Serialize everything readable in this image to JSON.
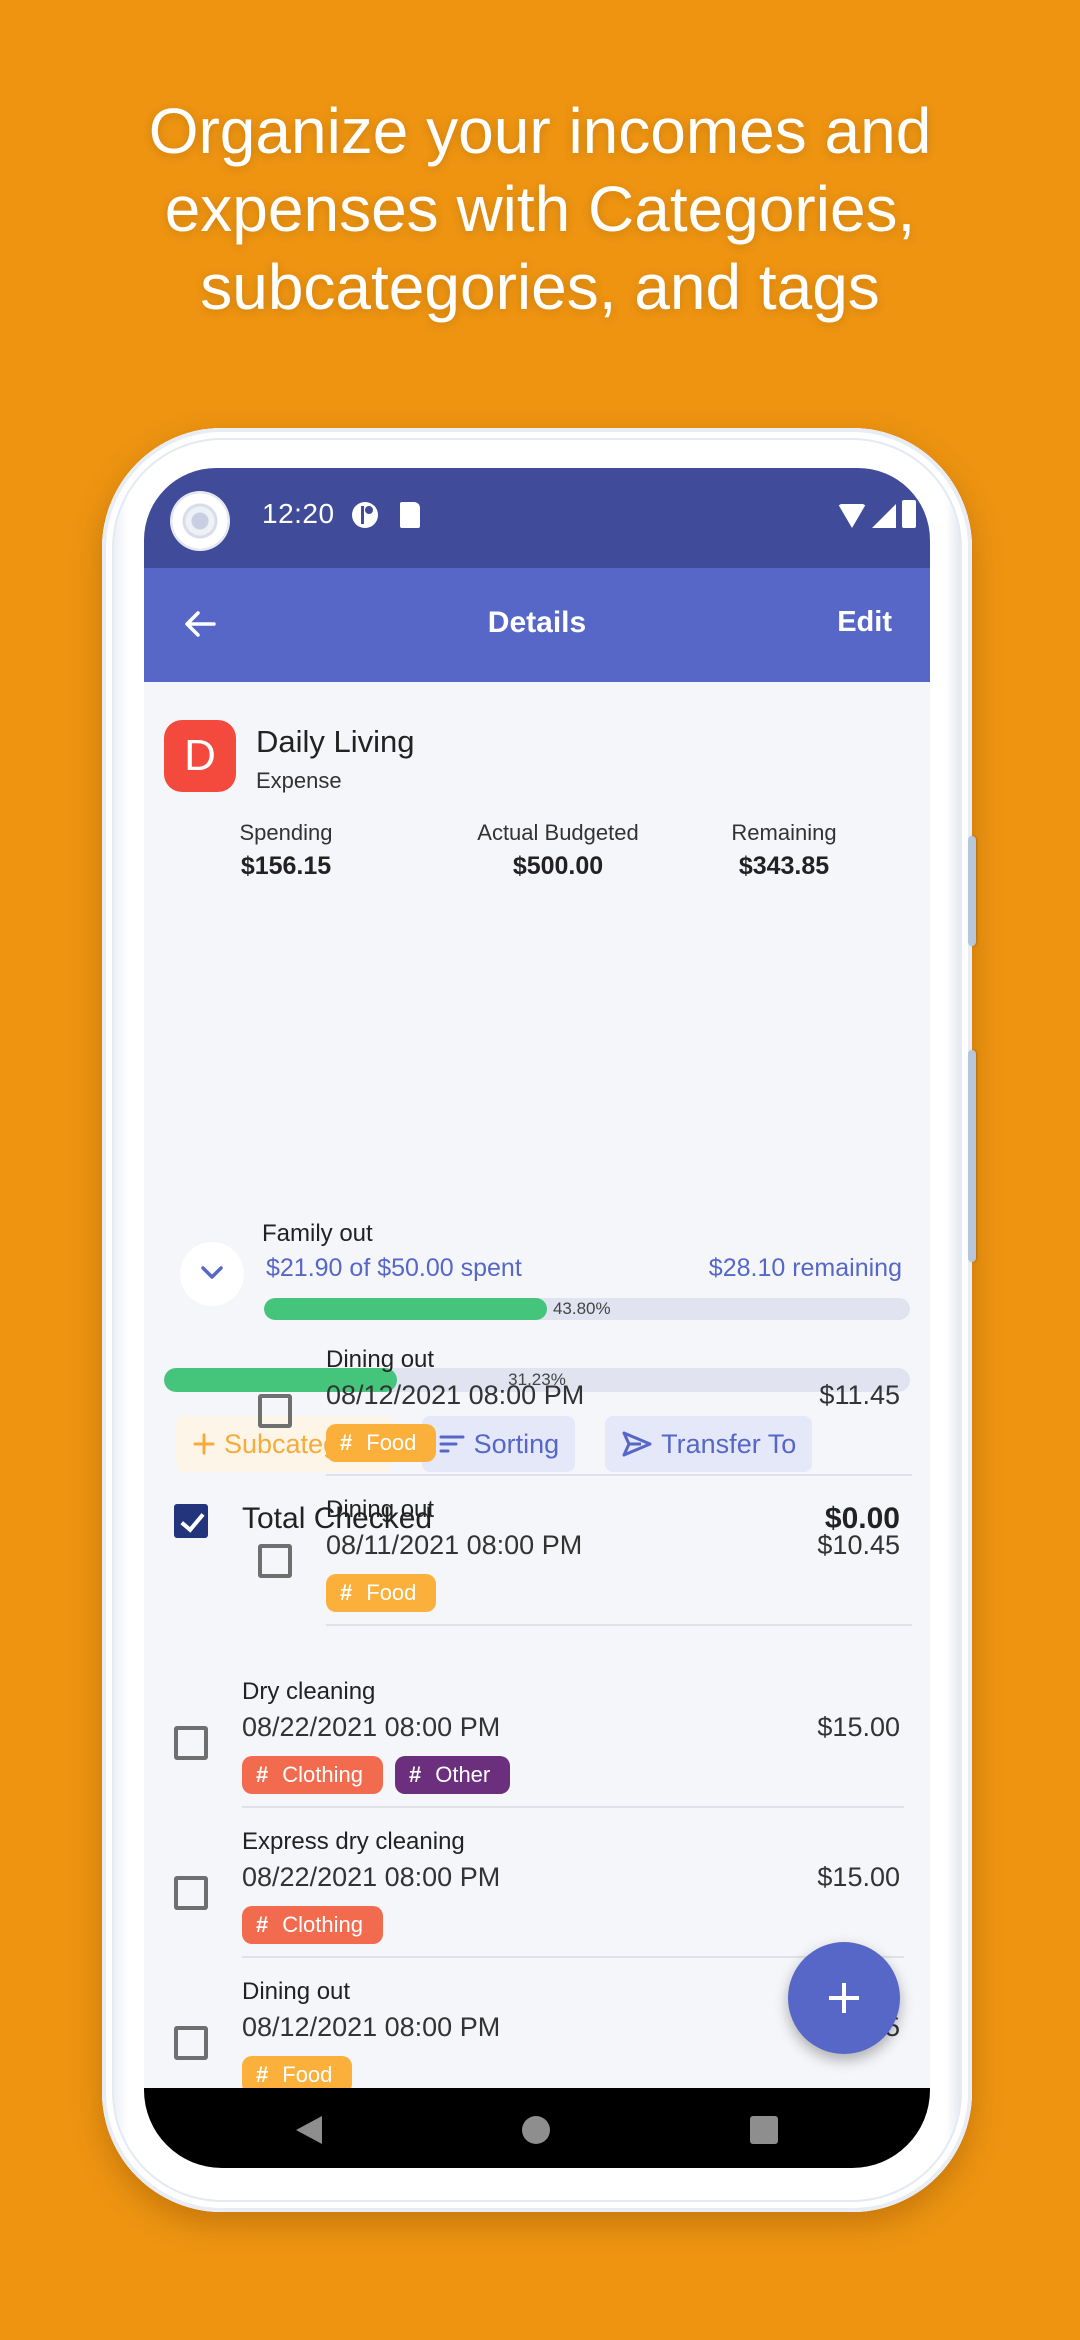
{
  "headline": {
    "lines": [
      "Organize your incomes and",
      "expenses with Categories,",
      "subcategories, and tags"
    ]
  },
  "status_bar": {
    "time": "12:20"
  },
  "app_bar": {
    "title": "Details",
    "edit_label": "Edit"
  },
  "category": {
    "initial": "D",
    "name": "Daily Living",
    "type": "Expense",
    "color": "#f34a3d",
    "summary": [
      {
        "label": "Spending",
        "value": "$156.15"
      },
      {
        "label": "Actual Budgeted",
        "value": "$500.00"
      },
      {
        "label": "Remaining",
        "value": "$343.85"
      }
    ],
    "progress_percent": 31.23,
    "progress_label": "31.23%"
  },
  "actions": {
    "subcategory_label": "Subcategory",
    "sorting_label": "Sorting",
    "transfer_label": "Transfer To"
  },
  "total_checked": {
    "label": "Total Checked",
    "value": "$0.00",
    "checked": true
  },
  "subcategory": {
    "name": "Family out",
    "spent_text": "$21.90 of $50.00 spent",
    "remaining_text": "$28.10 remaining",
    "progress_percent": 43.8,
    "progress_label": "43.80%",
    "expanded": true,
    "transactions": [
      {
        "name": "Dining out",
        "date": "08/12/2021 08:00 PM",
        "amount": "$11.45",
        "tags": [
          {
            "label": "Food",
            "color": "#fbb03b"
          }
        ]
      },
      {
        "name": "Dining out",
        "date": "08/11/2021 08:00 PM",
        "amount": "$10.45",
        "tags": [
          {
            "label": "Food",
            "color": "#fbb03b"
          }
        ]
      }
    ]
  },
  "transactions": [
    {
      "name": "Dry cleaning",
      "date": "08/22/2021 08:00 PM",
      "amount": "$15.00",
      "tags": [
        {
          "label": "Clothing",
          "color": "#f26b4f"
        },
        {
          "label": "Other",
          "color": "#6b2f7e"
        }
      ]
    },
    {
      "name": "Express dry cleaning",
      "date": "08/22/2021 08:00 PM",
      "amount": "$15.00",
      "tags": [
        {
          "label": "Clothing",
          "color": "#f26b4f"
        }
      ]
    },
    {
      "name": "Dining out",
      "date": "08/12/2021 08:00 PM",
      "amount": "$11.45",
      "tags": [
        {
          "label": "Food",
          "color": "#fbb03b"
        }
      ]
    },
    {
      "name": "Dining out",
      "date": "",
      "amount": "",
      "tags": []
    }
  ],
  "tag_icon": "hash-icon",
  "colors": {
    "background": "#ee9411",
    "status_bar": "#404c99",
    "app_bar": "#5667c8",
    "accent": "#5667c8",
    "progress": "#45c47b",
    "checkbox_checked": "#23337c"
  }
}
